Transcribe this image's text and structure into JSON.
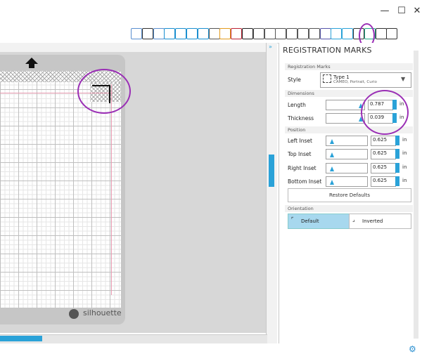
{
  "window": {
    "minimize": "—",
    "maximize": "☐",
    "close": "✕"
  },
  "toolbar": {
    "icons": [
      "select-icon",
      "page-icon",
      "grid-icon",
      "pentagon-icon",
      "star-icon",
      "shape-icon",
      "house-icon",
      "lasso-icon",
      "lines-icon",
      "colors-icon",
      "text-icon",
      "move-icon",
      "knife-icon",
      "pen-icon",
      "send-icon",
      "trace-icon",
      "replicate-icon",
      "offset-icon",
      "registration-icon",
      "cut-settings-icon",
      "library-icon",
      "store-icon",
      "eraser-icon",
      "more-icon"
    ]
  },
  "mat": {
    "brand": "silhouette"
  },
  "panel": {
    "title": "REGISTRATION MARKS",
    "section_registration": "Registration Marks",
    "style_label": "Style",
    "style_value_main": "Type 1",
    "style_value_sub": "CAMEO, Portrait, Curio",
    "section_dimensions": "Dimensions",
    "length_label": "Length",
    "length_value": "0.787",
    "thickness_label": "Thickness",
    "thickness_value": "0.039",
    "section_position": "Position",
    "left_inset_label": "Left Inset",
    "left_inset_value": "0.625",
    "top_inset_label": "Top Inset",
    "top_inset_value": "0.625",
    "right_inset_label": "Right Inset",
    "right_inset_value": "0.625",
    "bottom_inset_label": "Bottom Inset",
    "bottom_inset_value": "0.625",
    "unit": "in",
    "restore_label": "Restore Defaults",
    "section_orientation": "Orientation",
    "orientation_default": "Default",
    "orientation_inverted": "Inverted"
  },
  "colors": {
    "accent": "#2aa2d8",
    "highlight_circle": "#9a2fb5",
    "selected_bg": "#a7d8ee"
  }
}
